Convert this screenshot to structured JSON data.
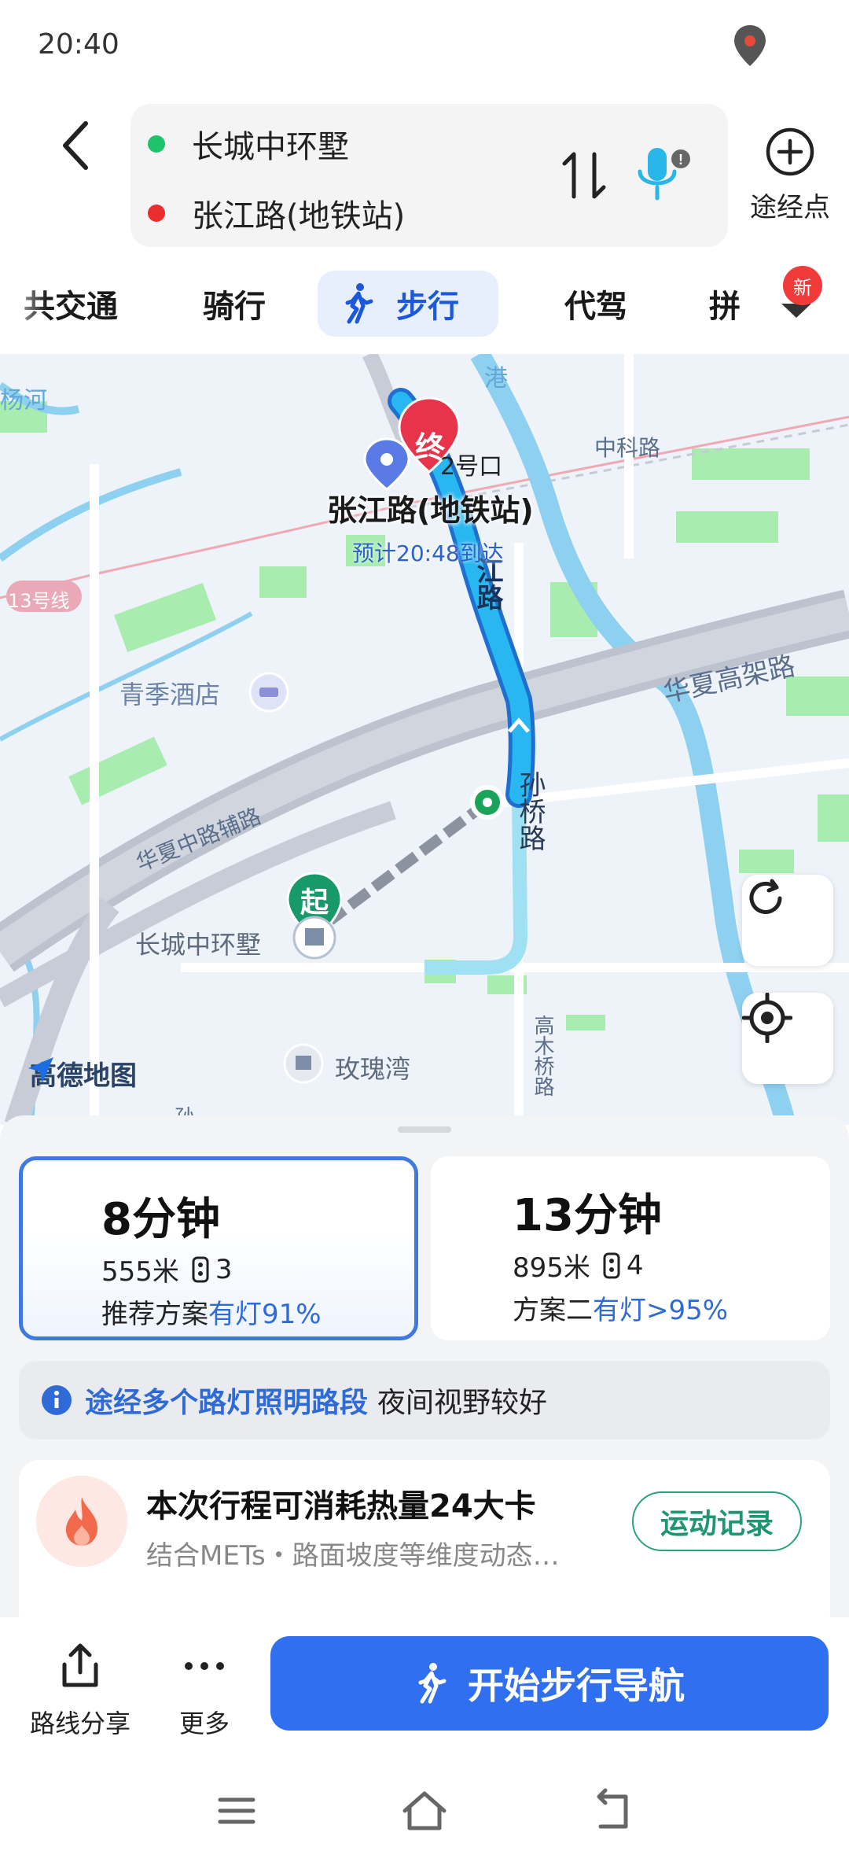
{
  "status_bar": {
    "time": "20:40"
  },
  "route": {
    "from": "长城中环墅",
    "to": "张江路(地铁站)",
    "waypoint_label": "途经点"
  },
  "tabs": [
    {
      "label": "共交通"
    },
    {
      "label": "骑行"
    },
    {
      "label": "步行",
      "active": true
    },
    {
      "label": "代驾"
    },
    {
      "label": "拼"
    }
  ],
  "tabs_new_badge": "新",
  "map": {
    "destination_marker": "终",
    "start_marker": "起",
    "destination_name": "张江路(地铁站)",
    "eta": "预计20:48到达",
    "labels": {
      "exit": "2号口",
      "kexue_rd": "中科路",
      "line13": "13号线",
      "hotel": "青季酒店",
      "huaxia_elevated": "华夏高架路",
      "huaxia_aux": "华夏中路辅路",
      "zhangjiang_rd": "江路",
      "sunqiao_rd": "孙桥路",
      "start_place": "长城中环墅",
      "gaomu_bridge": "高木桥路",
      "rose_bay": "玫瑰湾",
      "river_top": "港",
      "river_left": "杨河",
      "bottom_cut": "孙"
    },
    "logo": "高德地图"
  },
  "plans": [
    {
      "time": "8分钟",
      "distance": "555米",
      "lights": "3",
      "desc_prefix": "推荐方案",
      "desc_highlight": "有灯91%"
    },
    {
      "time": "13分钟",
      "distance": "895米",
      "lights": "4",
      "desc_prefix": "方案二",
      "desc_highlight": "有灯>95%"
    }
  ],
  "notice": {
    "highlight": "途经多个路灯照明路段",
    "rest": "夜间视野较好"
  },
  "calorie": {
    "title": "本次行程可消耗热量24大卡",
    "subtitle": "结合METs・路面坡度等维度动态…",
    "button": "运动记录"
  },
  "bottom": {
    "share": "路线分享",
    "more": "更多",
    "start_nav": "开始步行导航"
  },
  "colors": {
    "accent": "#2f6ff0",
    "route_blue": "#1aa7f0",
    "start_green": "#1a9a5a",
    "dest_red": "#e8344a"
  }
}
